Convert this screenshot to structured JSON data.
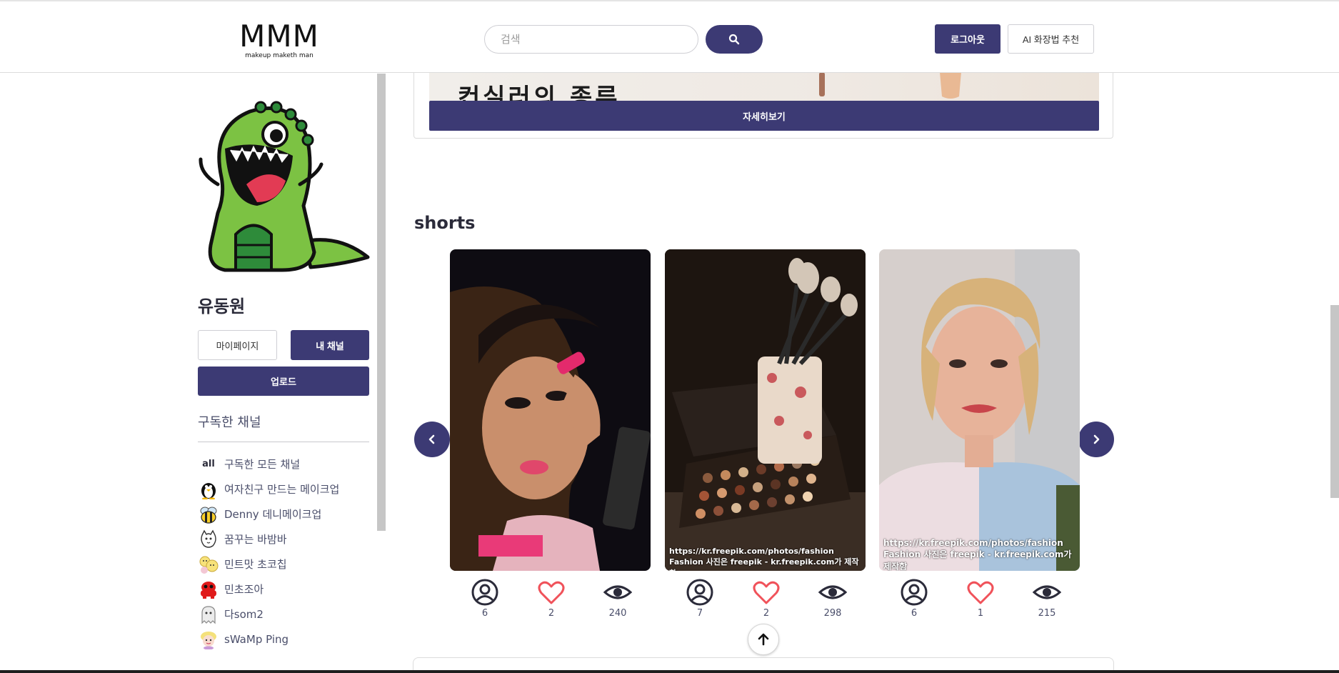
{
  "header": {
    "logo_text": "MMM",
    "logo_tagline": "makeup maketh man",
    "search_placeholder": "검색",
    "search_icon": "search-icon",
    "logout_label": "로그아웃",
    "ai_label": "AI 화장법 추천"
  },
  "sidebar": {
    "user_name": "유동원",
    "mypage_label": "마이페이지",
    "mychannel_label": "내 채널",
    "upload_label": "업로드",
    "subscriptions_title": "구독한 채널",
    "channels": [
      {
        "avatar": "all",
        "label": "구독한 모든 채널"
      },
      {
        "avatar": "penguin-avatar-icon",
        "label": "여자친구 만드는 메이크업"
      },
      {
        "avatar": "bee-avatar-icon",
        "label": "Denny 데니메이크업"
      },
      {
        "avatar": "cat-doodle-avatar-icon",
        "label": "꿈꾸는 바밤바"
      },
      {
        "avatar": "yellow-character-avatar-icon",
        "label": "민트맛 초코칩"
      },
      {
        "avatar": "red-character-avatar-icon",
        "label": "민초조아"
      },
      {
        "avatar": "ghost-avatar-icon",
        "label": "다som2"
      },
      {
        "avatar": "blonde-character-avatar-icon",
        "label": "sWaMp Ping"
      }
    ]
  },
  "main": {
    "banner_text": "컨실러의 종류",
    "detail_label": "자세히보기",
    "shorts_title": "shorts",
    "shorts": [
      {
        "credit": "",
        "subscribers": "6",
        "likes": "2",
        "views": "240"
      },
      {
        "credit": "https://kr.freepik.com/photos/fashion\nFashion 사진은 freepik - kr.freepik.com가 제작함",
        "subscribers": "7",
        "likes": "2",
        "views": "298"
      },
      {
        "credit": "https://kr.freepik.com/photos/fashion\nFashion 사진은 freepik - kr.freepik.com가 제작함",
        "subscribers": "6",
        "likes": "1",
        "views": "215"
      }
    ]
  },
  "colors": {
    "brand": "#3c3a74",
    "heart": "#f0525a",
    "text": "#2b2b3a"
  }
}
